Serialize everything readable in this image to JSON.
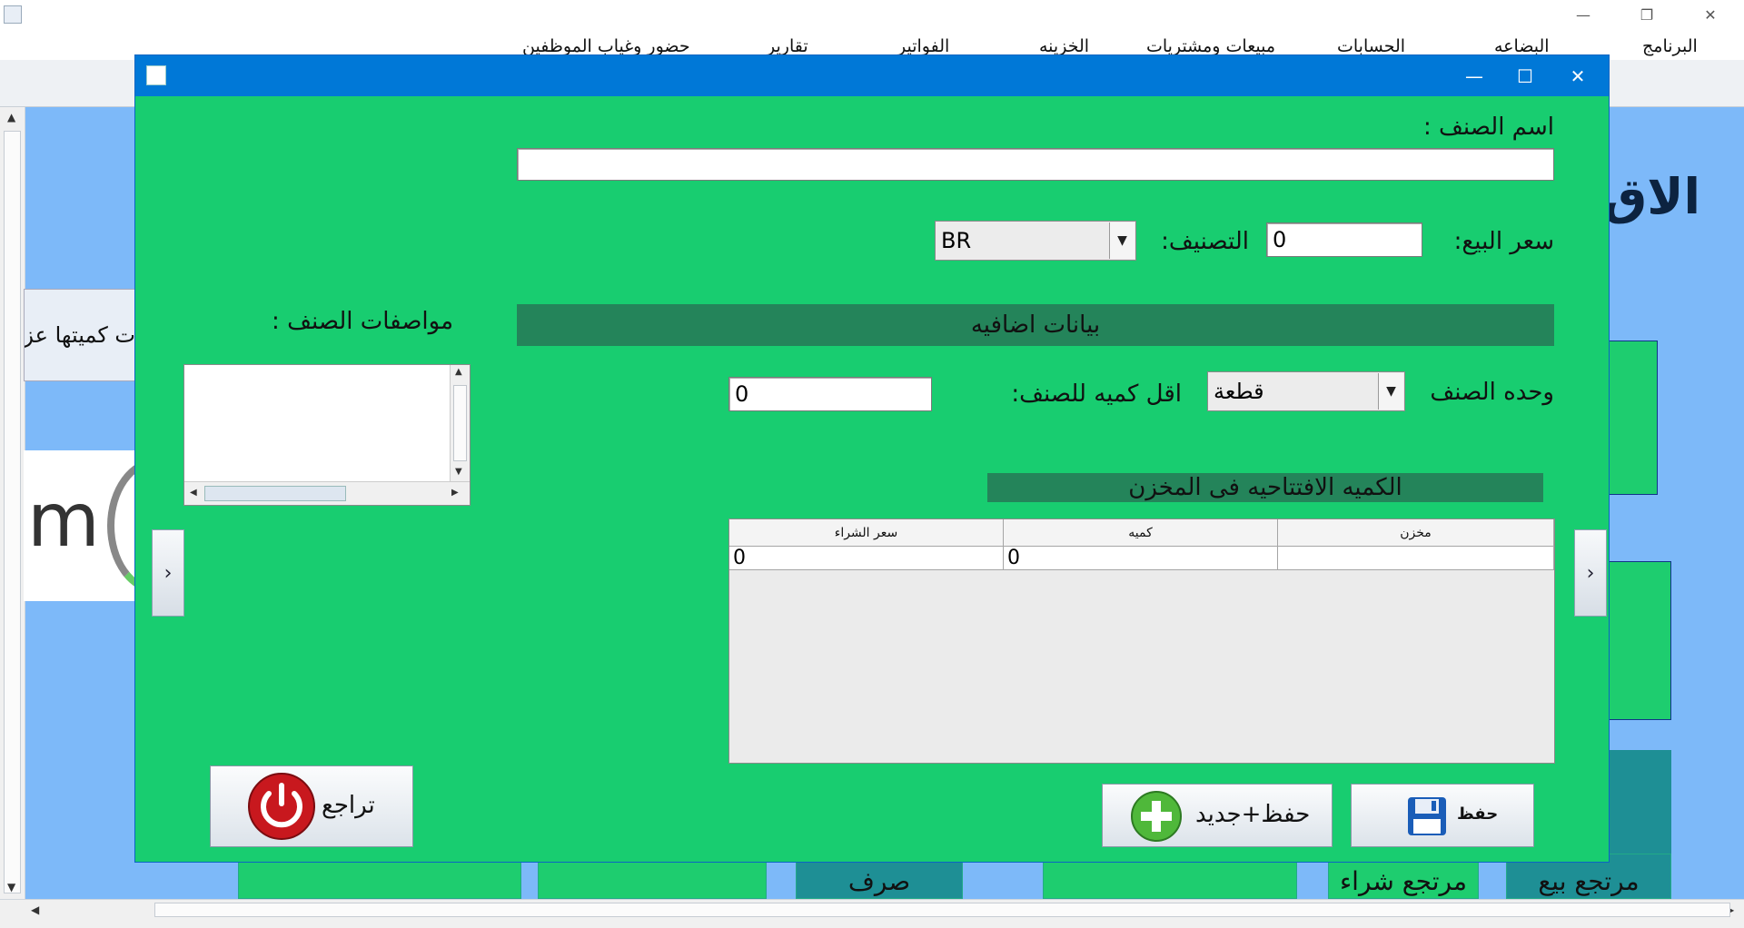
{
  "main_window": {
    "menu": [
      "البرنامج",
      "البضاعه",
      "الحسابات",
      "مبيعات ومشتريات",
      "الخزينه",
      "الفواتير",
      "تقارير",
      "حضور وغياب الموظفين"
    ],
    "window_controls": {
      "minimize": "—",
      "maximize": "❐",
      "close": "✕"
    }
  },
  "background": {
    "big_title": "الاق",
    "qty_card_text": "ت كميتها عز",
    "logo_text": "m",
    "tiles": [
      "مرتجع بيع",
      "مرتجع شراء",
      "صرف"
    ]
  },
  "dialog": {
    "controls": {
      "minimize": "—",
      "maximize": "☐",
      "close": "✕"
    },
    "item_name_label": "اسم الصنف :",
    "item_name_value": "",
    "sale_price_label": "سعر البيع:",
    "sale_price_value": "0",
    "category_label": "التصنيف:",
    "category_value": "BR",
    "extra_data_band": "بيانات اضافيه",
    "description_label": "مواصفات الصنف :",
    "description_value": "",
    "unit_label": "وحده الصنف",
    "unit_value": "قطعة",
    "min_qty_label": "اقل كميه للصنف:",
    "min_qty_value": "0",
    "opening_qty_band": "الكميه الافتتاحيه فى المخزن",
    "table": {
      "columns": [
        "مخزن",
        "كميه",
        "سعر الشراء"
      ],
      "rows": [
        [
          "",
          "0",
          "0"
        ]
      ]
    },
    "save_button": "حفظ",
    "save_new_button": "حفظ+جديد",
    "back_button": "تراجع"
  },
  "colors": {
    "dialog_bg": "#18cd70",
    "band_bg": "#24845a",
    "titlebar": "#0078d7",
    "desktop_bg": "#7db9f9"
  }
}
